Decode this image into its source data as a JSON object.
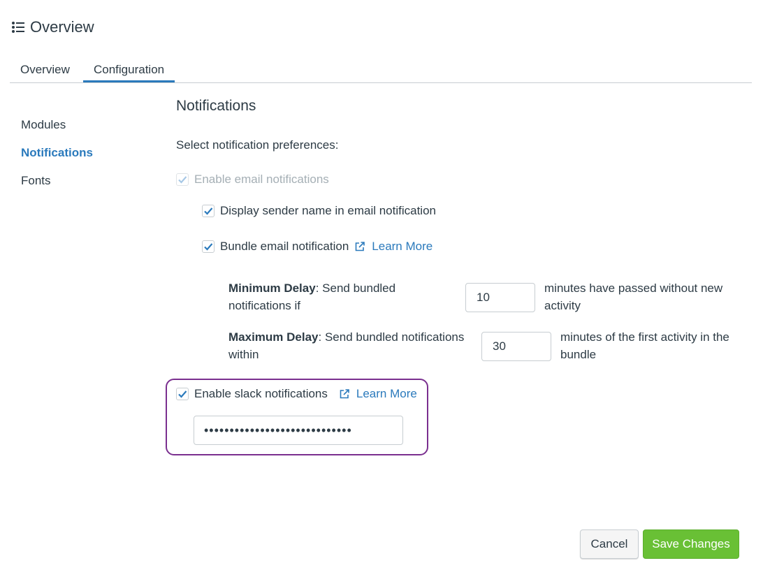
{
  "header": {
    "title": "Overview",
    "icon": "list-icon"
  },
  "tabs": [
    {
      "label": "Overview",
      "active": false
    },
    {
      "label": "Configuration",
      "active": true
    }
  ],
  "sidenav": {
    "items": [
      {
        "label": "Modules",
        "active": false
      },
      {
        "label": "Notifications",
        "active": true
      },
      {
        "label": "Fonts",
        "active": false
      }
    ]
  },
  "main": {
    "title": "Notifications",
    "subtitle": "Select notification preferences:",
    "email": {
      "label": "Enable email notifications",
      "checked": true,
      "disabled": true,
      "sender": {
        "label": "Display sender name in email notification",
        "checked": true
      },
      "bundle": {
        "label": "Bundle email notification",
        "checked": true,
        "link": "Learn More"
      },
      "min_delay": {
        "bold": "Minimum Delay",
        "text": ": Send bundled notifications if",
        "value": "10",
        "after": "minutes have passed without new activity"
      },
      "max_delay": {
        "bold": "Maximum Delay",
        "text": ": Send bundled notifications within",
        "value": "30",
        "after": "minutes of the first activity in the bundle"
      }
    },
    "slack": {
      "label": "Enable slack notifications",
      "checked": true,
      "link": "Learn More",
      "token_masked": "•••••••••••••••••••••••••••••"
    }
  },
  "actions": {
    "cancel": "Cancel",
    "save": "Save Changes"
  },
  "colors": {
    "accent": "#2b7abc",
    "save": "#69c035",
    "highlight": "#7a2f8f",
    "text": "#2d3b45",
    "disabled": "#a5afb5"
  }
}
